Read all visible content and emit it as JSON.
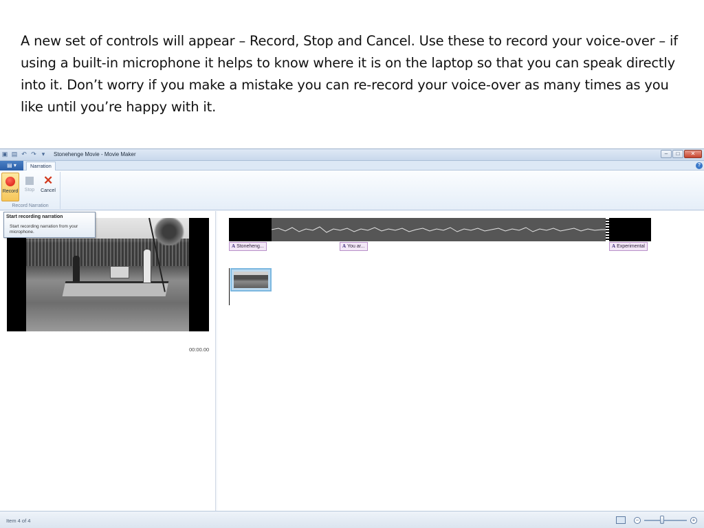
{
  "slide": {
    "text": "A new set of controls will appear – Record, Stop and Cancel. Use these to record your voice-over – if using a built-in microphone it helps to know where it is on the laptop so that you can speak directly into it. Don’t worry if you make a mistake you can re-record your voice-over as many times as you like until you’re happy with it."
  },
  "window": {
    "title": "Stonehenge Movie - Movie Maker",
    "minimize_icon": "minimize-icon",
    "maximize_icon": "maximize-icon",
    "close_icon": "close-icon"
  },
  "tabs": {
    "active": "Narration"
  },
  "ribbon": {
    "group_label": "Record Narration",
    "record_label": "Record",
    "stop_label": "Stop",
    "cancel_label": "Cancel"
  },
  "tooltip": {
    "title": "Start recording narration",
    "body": "Start recording narration from your microphone."
  },
  "preview": {
    "timecode": "00:00.00"
  },
  "timeline": {
    "captions": [
      "Stoneheng...",
      "You ar...",
      "Experimental"
    ]
  },
  "status": {
    "item_text": "Item 4 of 4"
  },
  "colors": {
    "record_red": "#d6160b",
    "cancel_red": "#d23b1f",
    "caption_bg": "#f3e7f7",
    "selected_clip_border": "#7bb7e0"
  }
}
